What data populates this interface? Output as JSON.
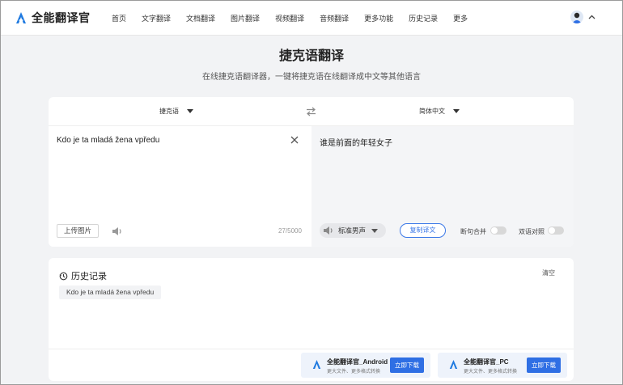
{
  "app": {
    "name": "全能翻译官"
  },
  "nav": {
    "items": [
      "首页",
      "文字翻译",
      "文档翻译",
      "图片翻译",
      "视频翻译",
      "音频翻译",
      "更多功能",
      "历史记录",
      "更多"
    ]
  },
  "page": {
    "title": "捷克语翻译",
    "subtitle": "在线捷克语翻译器，一键将捷克语在线翻译成中文等其他语言"
  },
  "translator": {
    "source_lang": "捷克语",
    "target_lang": "简体中文",
    "source_text": "Kdo je ta mladá žena vpředu",
    "target_text": "谁是前面的年轻女子",
    "upload_label": "上传图片",
    "char_count": "27/5000",
    "voice_label": "标准男声",
    "copy_label": "复制译文",
    "toggle_merge_label": "断句合并",
    "toggle_bilingual_label": "双语对照"
  },
  "history": {
    "title": "历史记录",
    "clear_label": "清空",
    "items": [
      "Kdo je ta mladá žena vpředu"
    ]
  },
  "downloads": [
    {
      "name": "全能翻译官_Android",
      "desc": "更大文件、更多格式转换",
      "button": "立即下载"
    },
    {
      "name": "全能翻译官_PC",
      "desc": "更大文件、更多格式转换",
      "button": "立即下载"
    }
  ],
  "colors": {
    "accent": "#2f6fe4",
    "logo": "#1f7ae0"
  }
}
